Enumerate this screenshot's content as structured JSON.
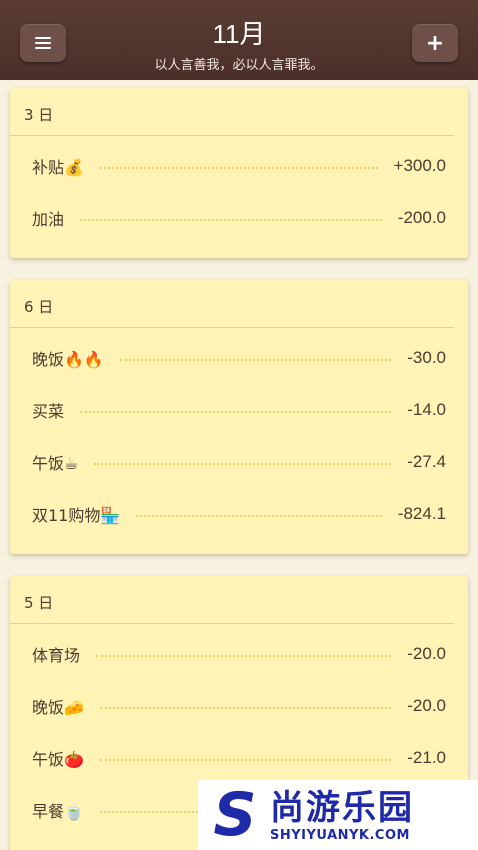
{
  "header": {
    "title": "11月",
    "subtitle": "以人言善我，必以人言罪我。",
    "menu_icon": "menu-icon",
    "add_label": "+"
  },
  "days": [
    {
      "label": "3 日",
      "entries": [
        {
          "name": "补贴💰",
          "amount": "+300.0"
        },
        {
          "name": "加油",
          "amount": "-200.0"
        }
      ]
    },
    {
      "label": "6 日",
      "entries": [
        {
          "name": "晚饭🔥🔥",
          "amount": "-30.0"
        },
        {
          "name": "买菜",
          "amount": "-14.0"
        },
        {
          "name": "午饭☕",
          "amount": "-27.4"
        },
        {
          "name": "双11购物🏪",
          "amount": "-824.1"
        }
      ]
    },
    {
      "label": "5 日",
      "entries": [
        {
          "name": "体育场",
          "amount": "-20.0"
        },
        {
          "name": "晚饭🧀",
          "amount": "-20.0"
        },
        {
          "name": "午饭🍅",
          "amount": "-21.0"
        },
        {
          "name": "早餐🍵",
          "amount": ""
        }
      ]
    }
  ],
  "watermark": {
    "logo": "S",
    "cn": "尚游乐园",
    "en": "SHYIYUANYK.COM"
  },
  "colors": {
    "header_bg": "#4b3029",
    "card_bg": "#fff3b6",
    "divider": "#f1d36a"
  }
}
